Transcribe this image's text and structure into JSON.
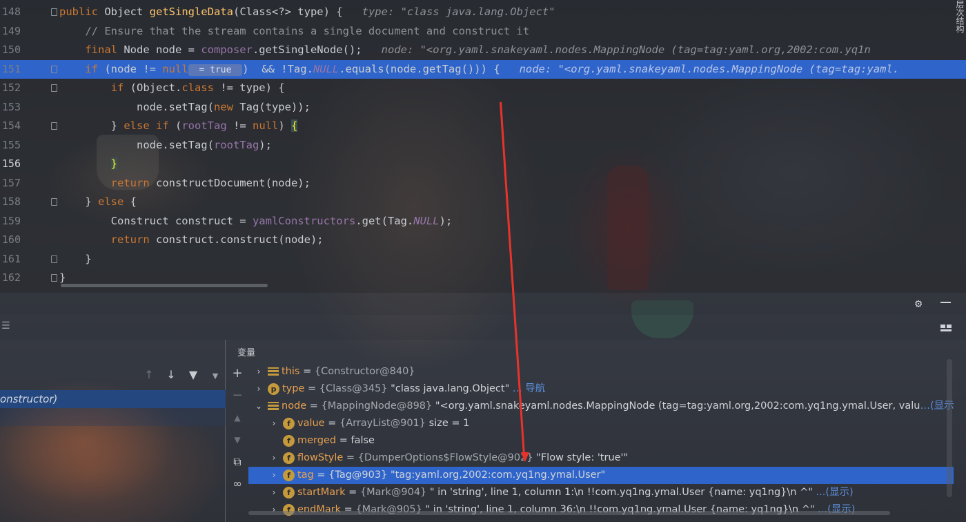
{
  "editor": {
    "lines": [
      {
        "n": "148",
        "parts": [
          [
            "kw",
            "public "
          ],
          [
            "",
            "Object "
          ],
          [
            "fn",
            "getSingleData"
          ],
          [
            "",
            "(Class<?> type) {  "
          ],
          [
            "hint",
            " type: \"class java.lang.Object\""
          ]
        ]
      },
      {
        "n": "149",
        "parts": [
          [
            "",
            "    "
          ],
          [
            "cm",
            "// Ensure that the stream contains a single document and construct it"
          ]
        ]
      },
      {
        "n": "150",
        "parts": [
          [
            "",
            "    "
          ],
          [
            "kw",
            "final "
          ],
          [
            "",
            "Node node = "
          ],
          [
            "fld",
            "composer"
          ],
          [
            "",
            ".getSingleNode();  "
          ],
          [
            "kw",
            ""
          ],
          [
            "hint",
            " node: \"<org.yaml.snakeyaml.nodes.MappingNode (tag=tag:yaml.org,2002:com.yq1n"
          ]
        ]
      },
      {
        "n": "151",
        "parts": [
          [
            "",
            "    "
          ],
          [
            "kw",
            "if "
          ],
          [
            "",
            "(node != "
          ],
          [
            "kw",
            "null"
          ],
          [
            "pill",
            " = true "
          ],
          [
            "",
            ")  && !Tag."
          ],
          [
            "fld it",
            "NULL"
          ],
          [
            "",
            ".equals(node.getTag())) {  "
          ],
          [
            "hint",
            " node: \"<org.yaml.snakeyaml.nodes.MappingNode (tag=tag:yaml."
          ]
        ]
      },
      {
        "n": "152",
        "parts": [
          [
            "",
            "        "
          ],
          [
            "kw",
            "if "
          ],
          [
            "",
            "(Object."
          ],
          [
            "kw",
            "class "
          ],
          [
            "",
            "!= type) {"
          ]
        ]
      },
      {
        "n": "153",
        "parts": [
          [
            "",
            "            node.setTag("
          ],
          [
            "kw",
            "new "
          ],
          [
            "",
            "Tag(type));"
          ]
        ]
      },
      {
        "n": "154",
        "parts": [
          [
            "",
            "        } "
          ],
          [
            "kw",
            "else if "
          ],
          [
            "",
            "("
          ],
          [
            "fld",
            "rootTag"
          ],
          [
            "",
            " != "
          ],
          [
            "kw",
            "null"
          ],
          [
            "",
            ") "
          ],
          [
            "brace",
            "{"
          ]
        ]
      },
      {
        "n": "155",
        "parts": [
          [
            "",
            "            node.setTag("
          ],
          [
            "fld",
            "rootTag"
          ],
          [
            "",
            ");"
          ]
        ]
      },
      {
        "n": "156",
        "parts": [
          [
            "",
            "        "
          ],
          [
            "brace",
            "}"
          ]
        ]
      },
      {
        "n": "157",
        "parts": [
          [
            "",
            "        "
          ],
          [
            "kw",
            "return "
          ],
          [
            "",
            "constructDocument(node);"
          ]
        ]
      },
      {
        "n": "158",
        "parts": [
          [
            "",
            "    } "
          ],
          [
            "kw",
            "else "
          ],
          [
            "",
            "{"
          ]
        ]
      },
      {
        "n": "159",
        "parts": [
          [
            "",
            "        Construct construct = "
          ],
          [
            "fld",
            "yamlConstructors"
          ],
          [
            "",
            ".get(Tag."
          ],
          [
            "fld it",
            "NULL"
          ],
          [
            "",
            ");"
          ]
        ]
      },
      {
        "n": "160",
        "parts": [
          [
            "",
            "        "
          ],
          [
            "kw",
            "return "
          ],
          [
            "",
            "construct.construct(node);"
          ]
        ]
      },
      {
        "n": "161",
        "parts": [
          [
            "",
            "    }"
          ]
        ]
      },
      {
        "n": "162",
        "parts": [
          [
            "",
            "}"
          ]
        ]
      }
    ],
    "highlight_line": "151",
    "current_line": "156",
    "right_tab_label": "层次结构"
  },
  "debugger": {
    "frame_selected": "onstructor)",
    "variables_title": "变量",
    "variables": [
      {
        "depth": 0,
        "arrow": "›",
        "icon": "lines",
        "name": "this",
        "eq": " = ",
        "type": "{Constructor@840}",
        "value": "",
        "link": ""
      },
      {
        "depth": 0,
        "arrow": "›",
        "icon": "p",
        "name": "type",
        "eq": " = ",
        "type": "{Class@345}",
        "value": " \"class java.lang.Object\"",
        "link": " ... 导航"
      },
      {
        "depth": 0,
        "arrow": "⌄",
        "icon": "lines",
        "name": "node",
        "eq": " = ",
        "type": "{MappingNode@898}",
        "value": " \"<org.yaml.snakeyaml.nodes.MappingNode (tag=tag:yaml.org,2002:com.yq1ng.ymal.User, valu",
        "link": "…(显示)"
      },
      {
        "depth": 1,
        "arrow": "›",
        "icon": "f",
        "name": "value",
        "eq": " = ",
        "type": "{ArrayList@901}",
        "value": "  size = 1",
        "link": ""
      },
      {
        "depth": 1,
        "arrow": "",
        "icon": "f",
        "name": "merged",
        "eq": " = ",
        "type": "",
        "value": "false",
        "link": ""
      },
      {
        "depth": 1,
        "arrow": "›",
        "icon": "f",
        "name": "flowStyle",
        "eq": " = ",
        "type": "{DumperOptions$FlowStyle@902}",
        "value": " \"Flow style: 'true'\"",
        "link": ""
      },
      {
        "depth": 1,
        "arrow": "›",
        "icon": "f",
        "name": "tag",
        "eq": " = ",
        "type": "",
        "value": "{Tag@903} \"tag:yaml.org,2002:com.yq1ng.ymal.User\"",
        "link": "",
        "selected": true
      },
      {
        "depth": 1,
        "arrow": "›",
        "icon": "f",
        "name": "startMark",
        "eq": " = ",
        "type": "{Mark@904}",
        "value": " \" in 'string', line 1, column 1:\\n     !!com.yq1ng.ymal.User {name: yq1ng}\\n     ^\"",
        "link": " ...(显示)"
      },
      {
        "depth": 1,
        "arrow": "›",
        "icon": "f",
        "name": "endMark",
        "eq": " = ",
        "type": "{Mark@905}",
        "value": " \" in 'string', line 1, column 36:\\n     !!com.yq1ng.ymal.User {name: yq1ng}\\n     ^\"",
        "link": " ...(显示)"
      }
    ]
  },
  "colors": {
    "selection": "#2f65ca",
    "keyword": "#cc7832",
    "function": "#ffc66d",
    "field": "#9876aa",
    "annotation_arrow": "#e8332b"
  }
}
